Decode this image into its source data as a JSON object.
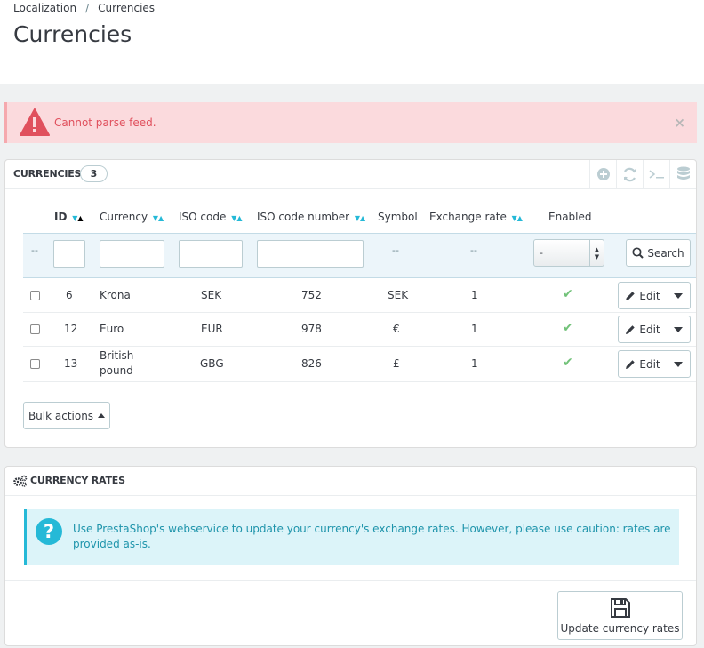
{
  "breadcrumb": {
    "parent": "Localization",
    "separator": "/",
    "current": "Currencies"
  },
  "page_title": "Currencies",
  "alert": {
    "message": "Cannot parse feed.",
    "close": "×"
  },
  "currencies_panel": {
    "title": "Currencies",
    "count": "3",
    "columns": {
      "id": "ID",
      "currency": "Currency",
      "iso_code": "ISO code",
      "iso_number": "ISO code number",
      "symbol": "Symbol",
      "exchange_rate": "Exchange rate",
      "enabled": "Enabled"
    },
    "filters": {
      "leading_dash": "--",
      "symbol_dash": "--",
      "rate_dash": "--",
      "enabled_select": "-",
      "search_label": "Search"
    },
    "rows": [
      {
        "id": "6",
        "currency": "Krona",
        "iso": "SEK",
        "number": "752",
        "symbol": "SEK",
        "rate": "1",
        "edit": "Edit"
      },
      {
        "id": "12",
        "currency": "Euro",
        "iso": "EUR",
        "number": "978",
        "symbol": "€",
        "rate": "1",
        "edit": "Edit"
      },
      {
        "id": "13",
        "currency_line1": "British",
        "currency_line2": "pound",
        "iso": "GBG",
        "number": "826",
        "symbol": "£",
        "rate": "1",
        "edit": "Edit"
      }
    ],
    "bulk_actions": "Bulk actions"
  },
  "rates_panel": {
    "title": "Currency rates",
    "info": "Use PrestaShop's webservice to update your currency's exchange rates. However, please use caution: rates are provided as-is.",
    "update_button": "Update currency rates"
  },
  "colors": {
    "accent": "#25b9d7",
    "danger": "#e0505d",
    "success": "#72c279"
  }
}
